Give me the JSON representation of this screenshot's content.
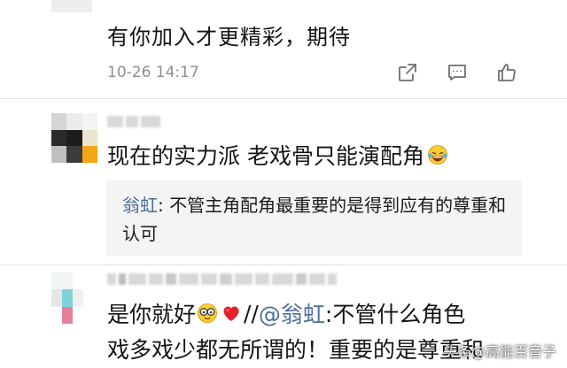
{
  "comments": [
    {
      "text": "有你加入才更精彩，期待",
      "time": "10-26 14:17",
      "actions": {
        "share_icon": "share-out-icon",
        "reply_icon": "comment-bubble-icon",
        "like_icon": "thumbs-up-icon"
      }
    },
    {
      "text": "现在的实力派 老戏骨只能演配角",
      "emoji": "laughing-tears-emoji",
      "quote": {
        "author": "翁虹",
        "separator": ": ",
        "body": "不管主角配角最重要的是得到应有的尊重和认可"
      }
    },
    {
      "line1_prefix": "是你就好",
      "line1_separator": "//",
      "mention": "@翁虹",
      "line1_suffix": ":不管什么角色",
      "line2": "戏多戏少都无所谓的！重要的是尊重和",
      "emojis": [
        "glasses-emoji",
        "red-heart-emoji"
      ]
    }
  ],
  "watermark": "头条@高能百音子",
  "colors": {
    "text": "#141414",
    "meta": "#8d8d8d",
    "link": "#4a6d9c",
    "quote_bg": "#f4f4f4",
    "divider": "#e3e3e3"
  }
}
